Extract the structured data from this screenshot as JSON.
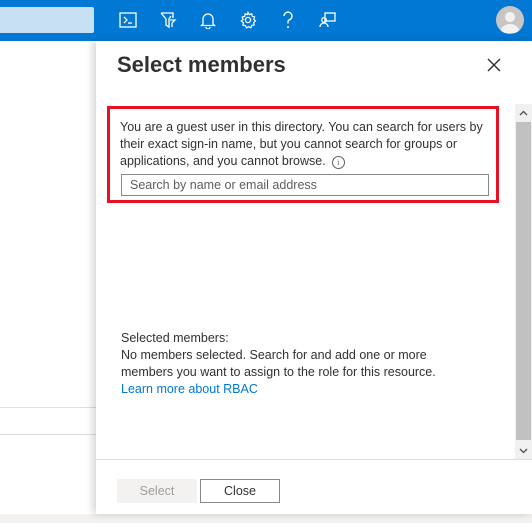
{
  "topbar": {
    "icons": [
      "cloud-shell-icon",
      "directory-filter-icon",
      "bell-icon",
      "gear-icon",
      "help-icon",
      "feedback-icon",
      "avatar"
    ]
  },
  "panel": {
    "title": "Select members",
    "guest_notice": "You are a guest user in this directory. You can search for users by their exact sign-in name, but you cannot search for groups or applications, and you cannot browse.",
    "search_placeholder": "Search by name or email address",
    "selected_heading": "Selected members:",
    "selected_empty": "No members selected. Search for and add one or more members you want to assign to the role for this resource.",
    "learn_more": "Learn more about RBAC",
    "select_label": "Select",
    "close_label": "Close"
  },
  "colors": {
    "accent": "#0078d4",
    "highlight_border": "#e81123"
  }
}
